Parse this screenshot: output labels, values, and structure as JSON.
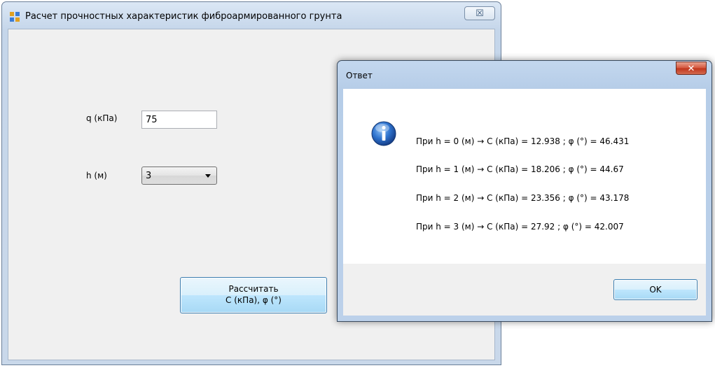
{
  "main_window": {
    "title": "Расчет прочностных характеристик фиброармированного грунта",
    "close_glyph": "☒",
    "q_label": "q (кПа)",
    "q_value": "75",
    "h_label": "h (м)",
    "h_value": "3",
    "calc_button_line1": "Рассчитать",
    "calc_button_line2": "С (кПа), φ (°)"
  },
  "message_box": {
    "title": "Ответ",
    "close_glyph": "✕",
    "icon": "info-icon",
    "lines": [
      "При h = 0 (м) → С (кПа) = 12.938 ; φ (°) = 46.431",
      "При h = 1 (м) → С (кПа) = 18.206 ; φ (°) = 44.67",
      "При h = 2 (м) → С (кПа) = 23.356 ; φ (°) = 43.178",
      "При h = 3 (м) → С (кПа) = 27.92 ; φ (°) = 42.007"
    ],
    "ok_label": "OK"
  },
  "colors": {
    "button_border": "#3c7fb1",
    "info_blue": "#1d5fb4",
    "close_red": "#c0331a"
  }
}
